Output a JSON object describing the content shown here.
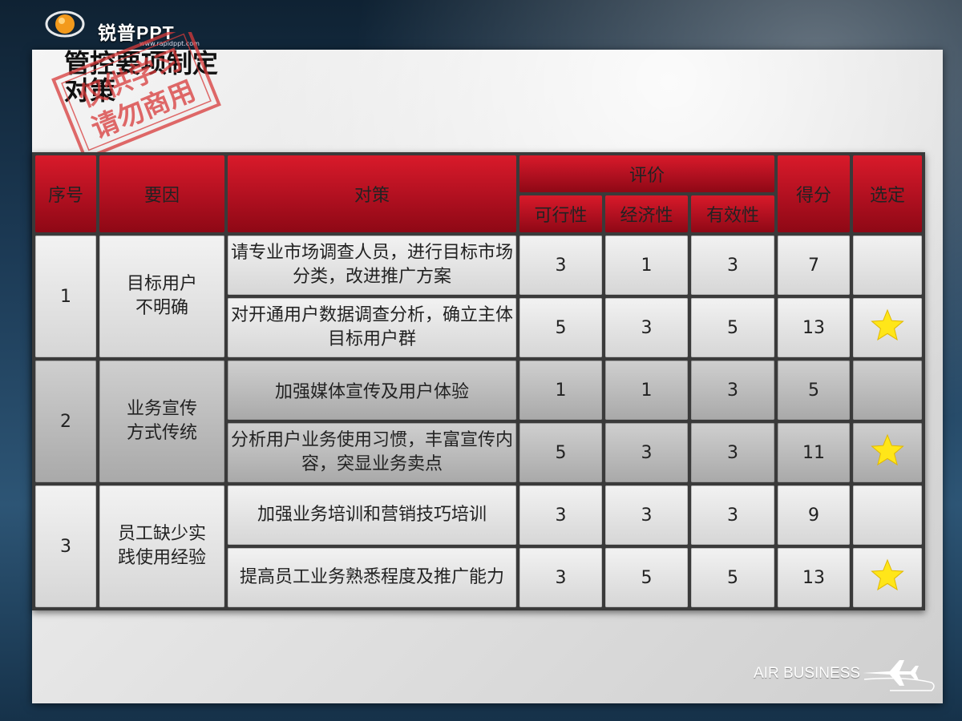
{
  "logo": {
    "text": "锐普PPT",
    "url": "www.rapidppt.com"
  },
  "title": "管控要项制定对策",
  "stamp": {
    "line1": "仅供学习",
    "line2": "请勿商用"
  },
  "table": {
    "headers": {
      "index": "序号",
      "cause": "要因",
      "measure": "对策",
      "evaluation": "评价",
      "feasibility": "可行性",
      "economy": "经济性",
      "effectiveness": "有效性",
      "score": "得分",
      "selected": "选定"
    },
    "groups": [
      {
        "index": "1",
        "cause": "目标用户\n不明确",
        "rows": [
          {
            "measure": "请专业市场调查人员，进行目标市场分类，改进推广方案",
            "feasibility": "3",
            "economy": "1",
            "effectiveness": "3",
            "score": "7",
            "selected": false
          },
          {
            "measure": "对开通用户数据调查分析，确立主体目标用户群",
            "feasibility": "5",
            "economy": "3",
            "effectiveness": "5",
            "score": "13",
            "selected": true
          }
        ]
      },
      {
        "index": "2",
        "cause": "业务宣传\n方式传统",
        "rows": [
          {
            "measure": "加强媒体宣传及用户体验",
            "feasibility": "1",
            "economy": "1",
            "effectiveness": "3",
            "score": "5",
            "selected": false
          },
          {
            "measure": "分析用户业务使用习惯，丰富宣传内容，突显业务卖点",
            "feasibility": "5",
            "economy": "3",
            "effectiveness": "3",
            "score": "11",
            "selected": true
          }
        ]
      },
      {
        "index": "3",
        "cause": "员工缺少实\n践使用经验",
        "rows": [
          {
            "measure": "加强业务培训和营销技巧培训",
            "feasibility": "3",
            "economy": "3",
            "effectiveness": "3",
            "score": "9",
            "selected": false
          },
          {
            "measure": "提高员工业务熟悉程度及推广能力",
            "feasibility": "3",
            "economy": "5",
            "effectiveness": "5",
            "score": "13",
            "selected": true
          }
        ]
      }
    ]
  },
  "brand": "AIR BUSINESS",
  "colors": {
    "header_red": "#c0141f",
    "star": "#ffe619"
  },
  "icons": {
    "selected_mark": "star-icon",
    "brand_mark": "airplane-icon",
    "logo_mark": "globe-logo-icon"
  }
}
